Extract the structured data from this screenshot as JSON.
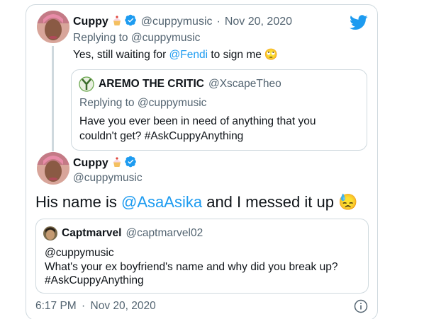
{
  "parent": {
    "name": "Cuppy",
    "handle": "@cuppymusic",
    "sep": "·",
    "date": "Nov 20, 2020",
    "replying_prefix": "Replying to ",
    "replying_to": "@cuppymusic",
    "text_before": "Yes, still waiting for ",
    "mention": "@Fendi",
    "text_after": " to sign me",
    "emoji": "🙄"
  },
  "parent_quote": {
    "name": "AREMO THE CRITIC",
    "handle": "@XscapeTheo",
    "replying_prefix": "Replying to ",
    "replying_to": "@cuppymusic",
    "text": "Have you ever been in need of anything that you couldn't get? #AskCuppyAnything"
  },
  "main": {
    "name": "Cuppy",
    "handle": "@cuppymusic",
    "text_before": "His name is ",
    "mention": "@AsaAsika",
    "text_after": " and I messed it up",
    "emoji": "😓",
    "time": "6:17 PM",
    "sep": "·",
    "date": "Nov 20, 2020"
  },
  "main_quote": {
    "name": "Captmarvel",
    "handle": "@captmarvel02",
    "line1": "@cuppymusic",
    "line2": "What's your ex boyfriend's name and why did you break up?",
    "line3": "#AskCuppyAnything"
  },
  "colors": {
    "accent": "#1d9bf0",
    "secondary_text": "#536471",
    "border": "#cfd9de"
  },
  "icons": {
    "brand": "twitter-bird-icon",
    "badge": "verified-badge-icon",
    "name_emoji": "cupcake-emoji",
    "info": "info-icon"
  }
}
